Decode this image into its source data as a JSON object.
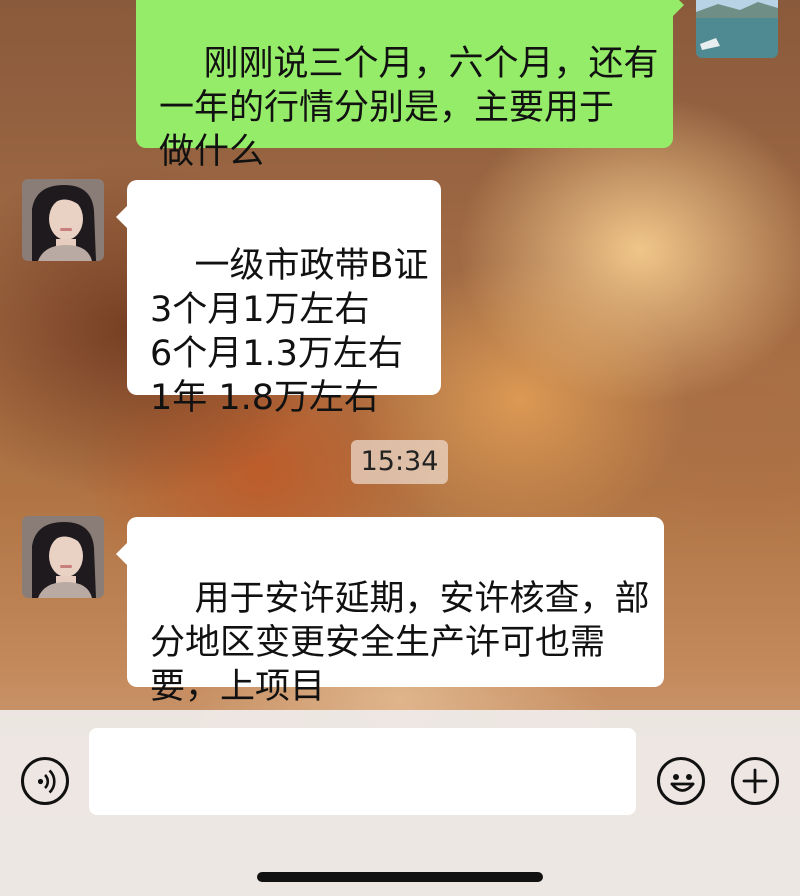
{
  "chat": {
    "messages": [
      {
        "sender": "me",
        "text": "刚刚说三个月，六个月，还有\n一年的行情分别是，主要用于\n做什么"
      },
      {
        "sender": "contact",
        "text": "一级市政带B证\n3个月1万左右\n6个月1.3万左右\n1年 1.8万左右"
      },
      {
        "sender": "contact",
        "text": "用于安许延期，安许核查，部\n分地区变更安全生产许可也需\n要，上项目"
      }
    ],
    "timestamp": "15:34"
  },
  "input_bar": {
    "message_value": "",
    "voice_icon": "voice-icon",
    "emoji_icon": "emoji-icon",
    "add_icon": "plus-icon"
  },
  "colors": {
    "my_bubble": "#95ec69",
    "contact_bubble": "#ffffff"
  }
}
